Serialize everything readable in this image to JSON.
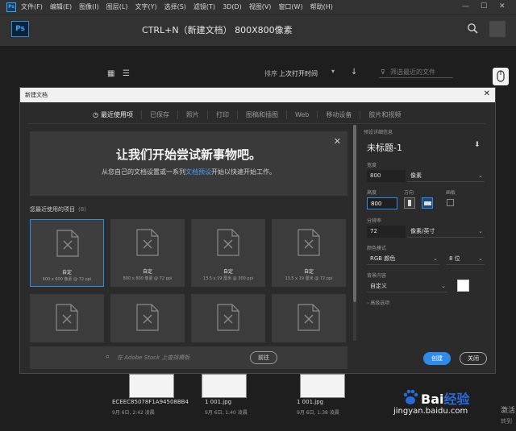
{
  "menubar": {
    "logo": "Ps",
    "items": [
      "文件(F)",
      "编辑(E)",
      "图像(I)",
      "图层(L)",
      "文字(Y)",
      "选择(S)",
      "滤镜(T)",
      "3D(D)",
      "视图(V)",
      "窗口(W)",
      "帮助(H)"
    ],
    "minimize": "—",
    "restore": "☐",
    "close": "✕"
  },
  "appbar": {
    "logo": "Ps",
    "title": "CTRL+N（新建文档）   800X800像素"
  },
  "toolbar": {
    "grid_icon": "▦",
    "list_icon": "☰",
    "sort_label": "排序",
    "sort_value": "上次打开时间",
    "sort_dropdown": "▾",
    "sort_arrow": "↓",
    "filter_icon": "⊽",
    "filter_placeholder": "筛选最近的文件"
  },
  "dialog": {
    "title": "新建文档",
    "close": "✕",
    "tabs": [
      "最近使用项",
      "已保存",
      "照片",
      "打印",
      "图稿和插图",
      "Web",
      "移动设备",
      "胶片和视频"
    ],
    "tab_clock": "◷",
    "welcome": {
      "heading": "让我们开始尝试新事物吧。",
      "sub_before": "从您自己的文档设置或一系列",
      "sub_link": "文档预设",
      "sub_after": "开始以快速开始工作。",
      "close": "✕"
    },
    "recent": {
      "label": "您最近使用的项目",
      "count": "(8)",
      "cards": [
        {
          "name": "自定",
          "meta": "600 x 600 像素 @ 72 ppi"
        },
        {
          "name": "自定",
          "meta": "800 x 800 像素 @ 72 ppi"
        },
        {
          "name": "自定",
          "meta": "13.5 x 19 厘米 @ 300 ppi"
        },
        {
          "name": "自定",
          "meta": "13.5 x 19 厘米 @ 72 ppi"
        }
      ]
    },
    "stock": {
      "icon": "⌕",
      "placeholder": "在 Adobe Stock 上查找模板",
      "go": "前往"
    },
    "preset": {
      "section": "预设详细信息",
      "name": "未标题-1",
      "save_icon": "⬇",
      "width_label": "宽度",
      "width": "800",
      "width_unit": "像素",
      "height_label": "高度",
      "height": "800",
      "orientation_label": "方向",
      "artboard_label": "画板",
      "resolution_label": "分辨率",
      "resolution": "72",
      "resolution_unit": "像素/英寸",
      "color_mode_label": "颜色模式",
      "color_mode": "RGB 颜色",
      "bit_depth": "8 位",
      "bg_label": "背景内容",
      "bg": "自定义",
      "bg_color": "#ffffff",
      "advanced": "› 高级选项",
      "chevron": "⌄"
    },
    "create": "创建",
    "close_btn": "关闭"
  },
  "files": [
    {
      "name": "ECEEC85078F1A94508BB4",
      "meta": "9月 6日, 2:42 凌晨"
    },
    {
      "name": "1 001.jpg",
      "meta": "9月 6日, 1:40 凌晨"
    },
    {
      "name": "1 001.jpg",
      "meta": "9月 6日, 1:38 凌晨"
    }
  ],
  "watermark": {
    "brand_a": "Bai",
    "brand_b": "经验",
    "url": "jingyan.baidu.com"
  },
  "corner": {
    "line1": "激活",
    "line2": "转到"
  }
}
